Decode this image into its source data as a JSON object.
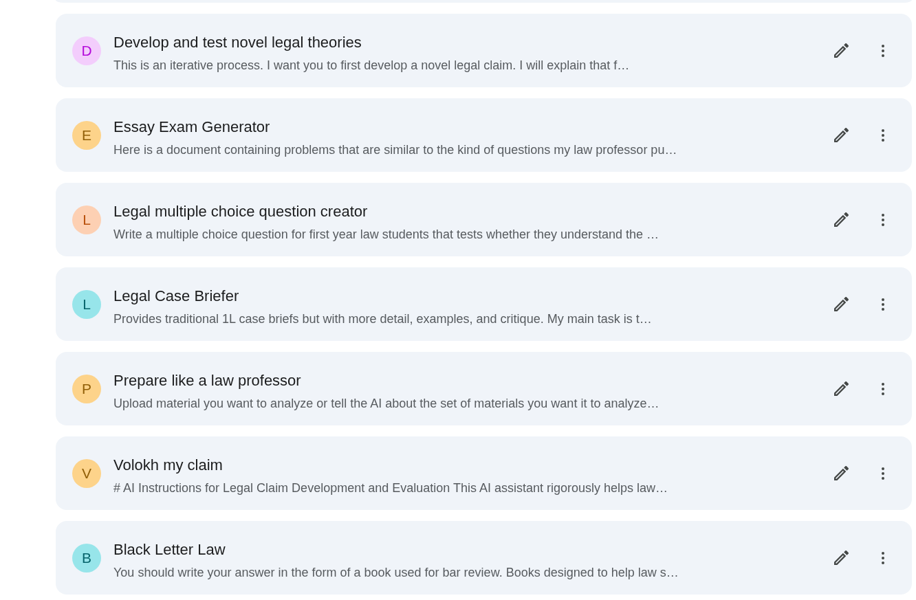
{
  "gems": [
    {
      "initial": "D",
      "color": "#f3cdfc",
      "title": "Develop and test novel legal theories",
      "description": "This is an iterative process. I want you to first develop a novel legal claim. I will explain that f…"
    },
    {
      "initial": "E",
      "color": "#fdd38a",
      "title": "Essay Exam Generator",
      "description": "Here is a document containing problems that are similar to the kind of questions my law professor pu…"
    },
    {
      "initial": "L",
      "color": "#fdd0b3",
      "title": "Legal multiple choice question creator",
      "description": "Write a multiple choice question for first year law students that tests whether they understand the …"
    },
    {
      "initial": "L",
      "color": "#97e5ea",
      "title": "Legal Case Briefer",
      "description": "Provides traditional 1L case briefs but with more detail, examples, and critique. My main task is t…"
    },
    {
      "initial": "P",
      "color": "#fdd38a",
      "title": "Prepare like a law professor",
      "description": "Upload material you want to analyze or tell the AI about the set of materials you want it to analyze…"
    },
    {
      "initial": "V",
      "color": "#fdd38a",
      "title": "Volokh my claim",
      "description": "# AI Instructions for Legal Claim Development and Evaluation This AI assistant rigorously helps law…"
    },
    {
      "initial": "B",
      "color": "#97e5ea",
      "title": "Black Letter Law",
      "description": "You should write your answer in the form of a book used for bar review. Books designed to help law s…"
    }
  ]
}
